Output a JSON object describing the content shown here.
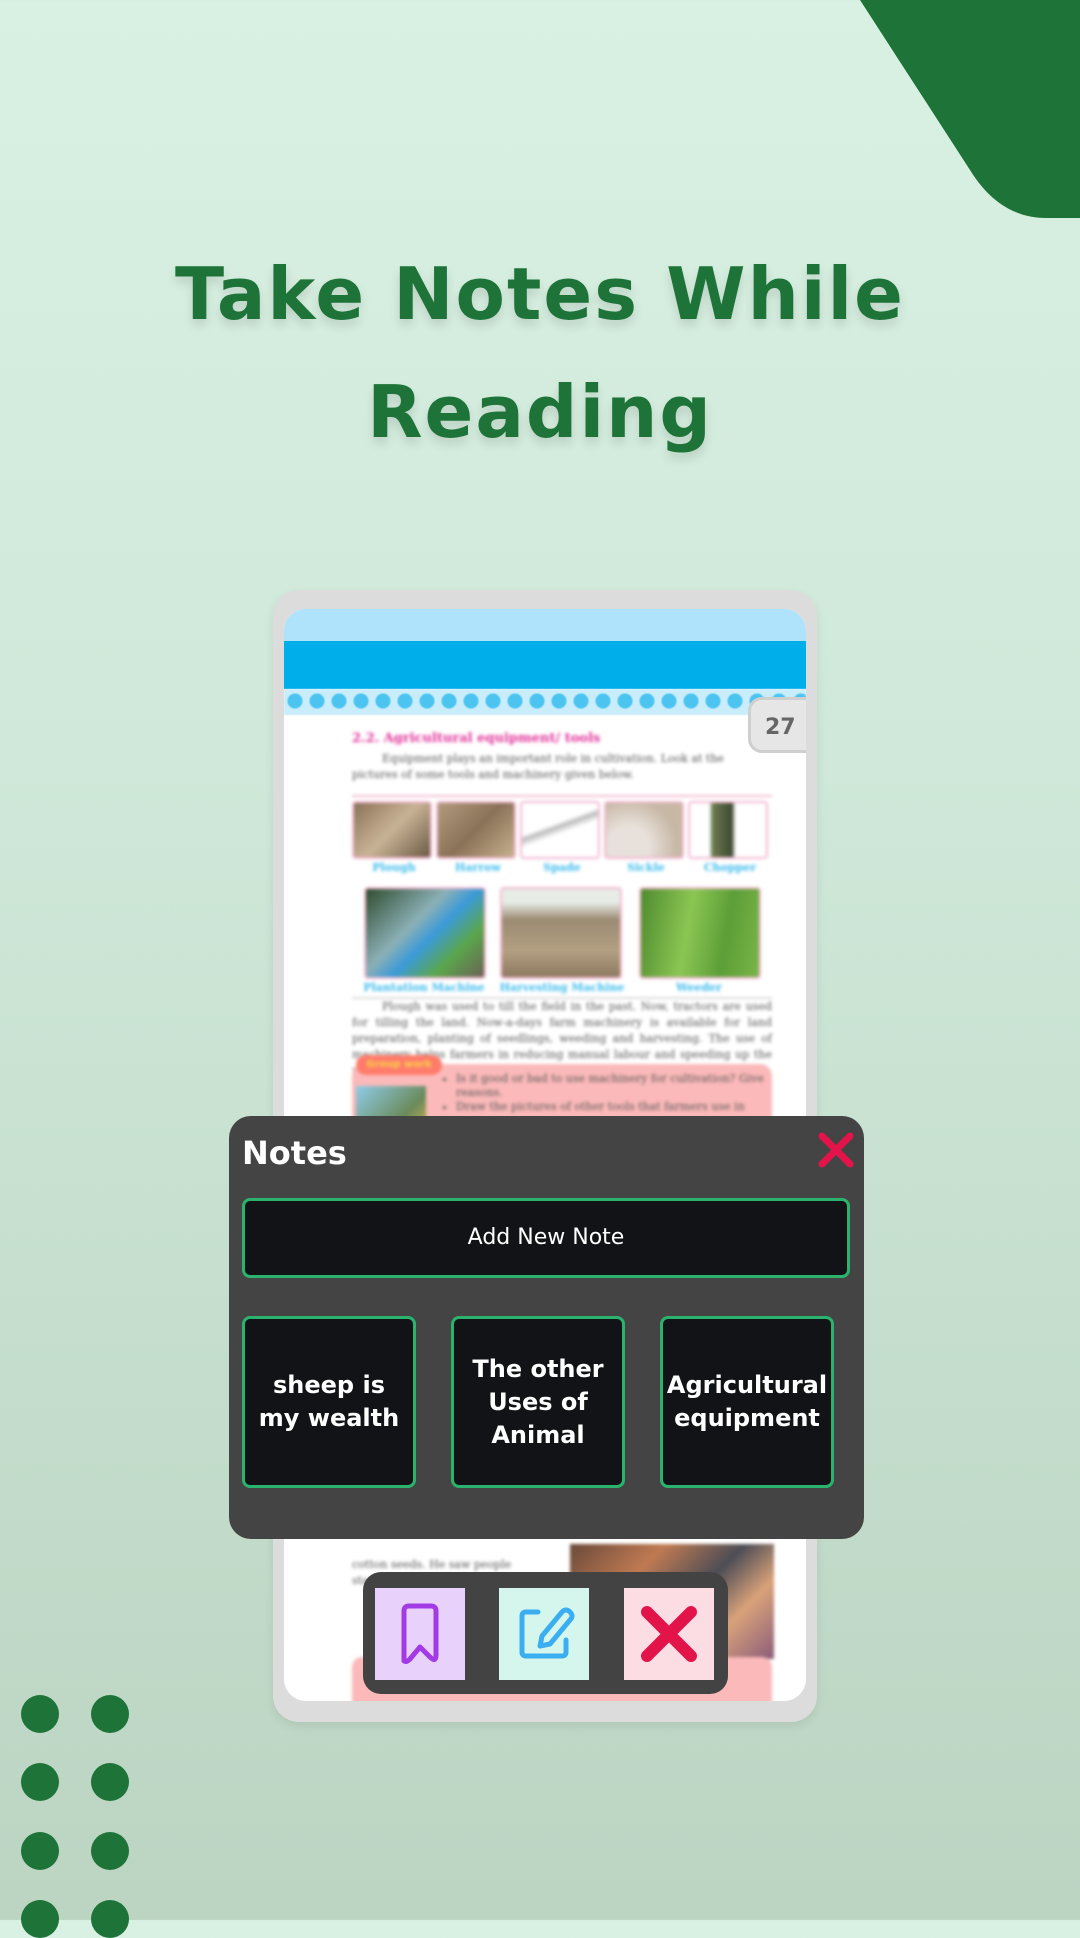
{
  "headline": {
    "line1": "Take Notes While",
    "line2": "Reading"
  },
  "colors": {
    "brand_green": "#1e7438",
    "accent_border": "#2bb36e",
    "close_red": "#e3144a",
    "dialog_bg": "#444444",
    "card_bg": "#121317"
  },
  "reader": {
    "page_number": "27",
    "section_title": "2.2. Agricultural equipment/ tools",
    "intro_text": "Equipment plays an important role in cultivation. Look at the pictures of some tools and machinery given below.",
    "tool_captions": [
      "Plough",
      "Harrow",
      "Spade",
      "Sickle",
      "Chopper"
    ],
    "machine_captions": [
      "Plantation Machine",
      "Harvesting Machine",
      "Weeder"
    ],
    "body_text": "Plough was used to till the field in the past. Now, tractors are used for tilling the land. Now-a-days farm machinery is available for land preparation, planting of seedlings, weeding and harvesting. The use of machinery helps farmers in reducing manual labour and speeding up the process of cultivation.",
    "group_work_label": "Group work",
    "group_work_items": [
      "Is it good or bad to use machinery for cultivation? Give reasons.",
      "Draw the pictures of other tools that farmers use in"
    ],
    "lower_text": "cotton seeds. He saw people standing"
  },
  "notes_dialog": {
    "title": "Notes",
    "close_icon": "close-icon",
    "add_button_label": "Add New Note",
    "notes": [
      {
        "label": "sheep is my wealth"
      },
      {
        "label": "The other Uses of Animal"
      },
      {
        "label": "Agricultural equipment"
      }
    ]
  },
  "toolbar": {
    "buttons": [
      {
        "icon": "bookmark-icon",
        "bg": "#e8d2fb",
        "color": "#a23be6"
      },
      {
        "icon": "edit-note-icon",
        "bg": "#d4f6ec",
        "color": "#3aaef0"
      },
      {
        "icon": "close-icon",
        "bg": "#fbdde3",
        "color": "#e3144a"
      }
    ]
  }
}
